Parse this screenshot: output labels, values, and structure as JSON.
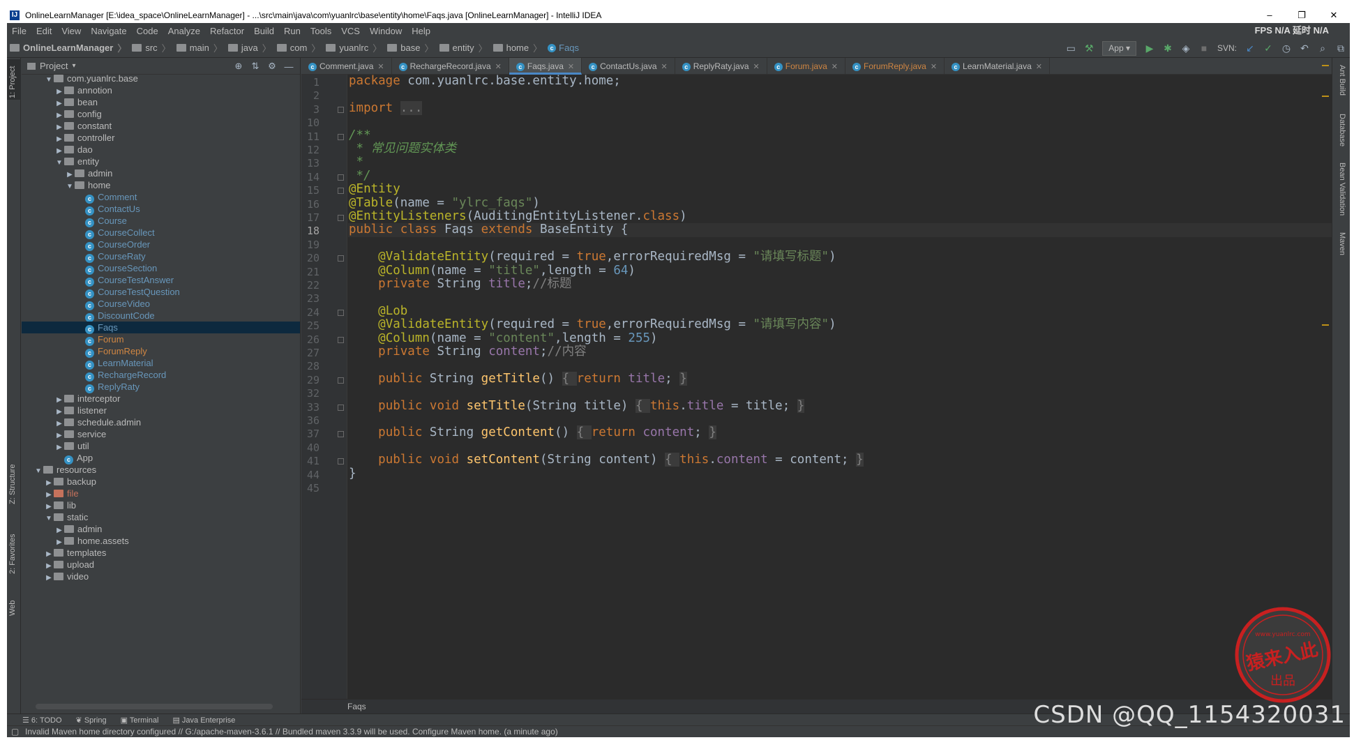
{
  "window": {
    "title": "OnlineLearnManager [E:\\idea_space\\OnlineLearnManager] - ...\\src\\main\\java\\com\\yuanlrc\\base\\entity\\home\\Faqs.java [OnlineLearnManager] - IntelliJ IDEA",
    "minimize": "–",
    "maximize": "❐",
    "close": "✕"
  },
  "menu": {
    "items": [
      "File",
      "Edit",
      "View",
      "Navigate",
      "Code",
      "Analyze",
      "Refactor",
      "Build",
      "Run",
      "Tools",
      "VCS",
      "Window",
      "Help"
    ],
    "fps": "FPS N/A 延时 N/A"
  },
  "breadcrumb": [
    "OnlineLearnManager",
    "src",
    "main",
    "java",
    "com",
    "yuanlrc",
    "base",
    "entity",
    "home",
    "Faqs"
  ],
  "toolbar": {
    "run_config": "App",
    "svn_label": "SVN:"
  },
  "project_panel": {
    "title": "Project",
    "tree": [
      {
        "label": "com.yuanlrc.base",
        "depth": 4,
        "type": "folder",
        "open": true
      },
      {
        "label": "annotion",
        "depth": 5,
        "type": "folder"
      },
      {
        "label": "bean",
        "depth": 5,
        "type": "folder"
      },
      {
        "label": "config",
        "depth": 5,
        "type": "folder"
      },
      {
        "label": "constant",
        "depth": 5,
        "type": "folder"
      },
      {
        "label": "controller",
        "depth": 5,
        "type": "folder"
      },
      {
        "label": "dao",
        "depth": 5,
        "type": "folder"
      },
      {
        "label": "entity",
        "depth": 5,
        "type": "folder",
        "open": true
      },
      {
        "label": "admin",
        "depth": 6,
        "type": "folder"
      },
      {
        "label": "home",
        "depth": 6,
        "type": "folder",
        "open": true
      },
      {
        "label": "Comment",
        "depth": 7,
        "type": "class",
        "color": "blue"
      },
      {
        "label": "ContactUs",
        "depth": 7,
        "type": "class",
        "color": "blue"
      },
      {
        "label": "Course",
        "depth": 7,
        "type": "class",
        "color": "blue"
      },
      {
        "label": "CourseCollect",
        "depth": 7,
        "type": "class",
        "color": "blue"
      },
      {
        "label": "CourseOrder",
        "depth": 7,
        "type": "class",
        "color": "blue"
      },
      {
        "label": "CourseRaty",
        "depth": 7,
        "type": "class",
        "color": "blue"
      },
      {
        "label": "CourseSection",
        "depth": 7,
        "type": "class",
        "color": "blue"
      },
      {
        "label": "CourseTestAnswer",
        "depth": 7,
        "type": "class",
        "color": "blue"
      },
      {
        "label": "CourseTestQuestion",
        "depth": 7,
        "type": "class",
        "color": "blue"
      },
      {
        "label": "CourseVideo",
        "depth": 7,
        "type": "class",
        "color": "blue"
      },
      {
        "label": "DiscountCode",
        "depth": 7,
        "type": "class",
        "color": "blue"
      },
      {
        "label": "Faqs",
        "depth": 7,
        "type": "class",
        "color": "blue",
        "selected": true
      },
      {
        "label": "Forum",
        "depth": 7,
        "type": "class",
        "color": "orange"
      },
      {
        "label": "ForumReply",
        "depth": 7,
        "type": "class",
        "color": "orange"
      },
      {
        "label": "LearnMaterial",
        "depth": 7,
        "type": "class",
        "color": "blue"
      },
      {
        "label": "RechargeRecord",
        "depth": 7,
        "type": "class",
        "color": "blue"
      },
      {
        "label": "ReplyRaty",
        "depth": 7,
        "type": "class",
        "color": "blue"
      },
      {
        "label": "interceptor",
        "depth": 5,
        "type": "folder"
      },
      {
        "label": "listener",
        "depth": 5,
        "type": "folder"
      },
      {
        "label": "schedule.admin",
        "depth": 5,
        "type": "folder"
      },
      {
        "label": "service",
        "depth": 5,
        "type": "folder"
      },
      {
        "label": "util",
        "depth": 5,
        "type": "folder"
      },
      {
        "label": "App",
        "depth": 5,
        "type": "class",
        "color": "plain"
      },
      {
        "label": "resources",
        "depth": 3,
        "type": "folder",
        "open": true
      },
      {
        "label": "backup",
        "depth": 4,
        "type": "folder"
      },
      {
        "label": "file",
        "depth": 4,
        "type": "folder-red",
        "color": "red"
      },
      {
        "label": "lib",
        "depth": 4,
        "type": "folder"
      },
      {
        "label": "static",
        "depth": 4,
        "type": "folder",
        "open": true
      },
      {
        "label": "admin",
        "depth": 5,
        "type": "folder"
      },
      {
        "label": "home.assets",
        "depth": 5,
        "type": "folder"
      },
      {
        "label": "templates",
        "depth": 4,
        "type": "folder"
      },
      {
        "label": "upload",
        "depth": 4,
        "type": "folder"
      },
      {
        "label": "video",
        "depth": 4,
        "type": "folder"
      }
    ]
  },
  "tabs": [
    {
      "label": "Comment.java",
      "active": false
    },
    {
      "label": "RechargeRecord.java",
      "active": false
    },
    {
      "label": "Faqs.java",
      "active": true
    },
    {
      "label": "ContactUs.java",
      "active": false
    },
    {
      "label": "ReplyRaty.java",
      "active": false
    },
    {
      "label": "Forum.java",
      "active": false,
      "color": "orange"
    },
    {
      "label": "ForumReply.java",
      "active": false,
      "color": "orange"
    },
    {
      "label": "LearnMaterial.java",
      "active": false
    }
  ],
  "editor": {
    "current_line": "18",
    "footer_crumb": "Faqs",
    "lines": [
      {
        "n": "1",
        "html": "<span class=\"kw\">package</span> com.yuanlrc.base.entity.home;"
      },
      {
        "n": "2",
        "html": ""
      },
      {
        "n": "3",
        "html": "<span class=\"kw\">import</span> <span class=\"fb\">...</span>"
      },
      {
        "n": "10",
        "html": ""
      },
      {
        "n": "11",
        "html": "<span class=\"cm\">/**</span>"
      },
      {
        "n": "12",
        "html": "<span class=\"cm\"> * 常见问题实体类</span>"
      },
      {
        "n": "13",
        "html": "<span class=\"cm\"> *</span>"
      },
      {
        "n": "14",
        "html": "<span class=\"cm\"> */</span>"
      },
      {
        "n": "15",
        "html": "<span class=\"an\">@Entity</span>"
      },
      {
        "n": "16",
        "html": "<span class=\"an\">@Table</span>(name = <span class=\"st\">\"ylrc_faqs\"</span>)"
      },
      {
        "n": "17",
        "html": "<span class=\"an\">@EntityListeners</span>(AuditingEntityListener.<span class=\"kw\">class</span>)"
      },
      {
        "n": "18",
        "html": "<span class=\"kw\">public class</span> Faqs <span class=\"kw\">extends</span> BaseEntity {"
      },
      {
        "n": "19",
        "html": ""
      },
      {
        "n": "20",
        "html": "    <span class=\"an\">@ValidateEntity</span>(required = <span class=\"kw\">true</span>,errorRequiredMsg = <span class=\"st\">\"请填写标题\"</span>)"
      },
      {
        "n": "21",
        "html": "    <span class=\"an\">@Column</span>(name = <span class=\"st\">\"title\"</span>,length = <span class=\"nm\">64</span>)"
      },
      {
        "n": "22",
        "html": "    <span class=\"kw\">private</span> String <span class=\"fd\">title</span>;<span class=\"lc\">//标题</span>"
      },
      {
        "n": "23",
        "html": ""
      },
      {
        "n": "24",
        "html": "    <span class=\"an\">@Lob</span>"
      },
      {
        "n": "25",
        "html": "    <span class=\"an\">@ValidateEntity</span>(required = <span class=\"kw\">true</span>,errorRequiredMsg = <span class=\"st\">\"请填写内容\"</span>)"
      },
      {
        "n": "26",
        "html": "    <span class=\"an\">@Column</span>(name = <span class=\"st\">\"content\"</span>,length = <span class=\"nm\">255</span>)"
      },
      {
        "n": "27",
        "html": "    <span class=\"kw\">private</span> String <span class=\"fd\">content</span>;<span class=\"lc\">//内容</span>"
      },
      {
        "n": "28",
        "html": ""
      },
      {
        "n": "29",
        "html": "    <span class=\"kw\">public</span> String <span class=\"fn\">getTitle</span>() <span class=\"fb\">{ </span><span class=\"kw\">return</span> <span class=\"fd\">title</span>; <span class=\"fb\">}</span>"
      },
      {
        "n": "32",
        "html": ""
      },
      {
        "n": "33",
        "html": "    <span class=\"kw\">public void</span> <span class=\"fn\">setTitle</span>(String title) <span class=\"fb\">{ </span><span class=\"kw\">this</span>.<span class=\"fd\">title</span> = title; <span class=\"fb\">}</span>"
      },
      {
        "n": "36",
        "html": ""
      },
      {
        "n": "37",
        "html": "    <span class=\"kw\">public</span> String <span class=\"fn\">getContent</span>() <span class=\"fb\">{ </span><span class=\"kw\">return</span> <span class=\"fd\">content</span>; <span class=\"fb\">}</span>"
      },
      {
        "n": "40",
        "html": ""
      },
      {
        "n": "41",
        "html": "    <span class=\"kw\">public void</span> <span class=\"fn\">setContent</span>(String content) <span class=\"fb\">{ </span><span class=\"kw\">this</span>.<span class=\"fd\">content</span> = content; <span class=\"fb\">}</span>"
      },
      {
        "n": "44",
        "html": "}"
      },
      {
        "n": "45",
        "html": ""
      }
    ]
  },
  "side_tools": {
    "left": [
      "1: Project",
      "Z: Structure",
      "2: Favorites",
      "Web"
    ],
    "right": [
      "Ant Build",
      "Database",
      "Bean Validation",
      "Maven"
    ]
  },
  "bottom_tools": [
    "6: TODO",
    "Spring",
    "Terminal",
    "Java Enterprise"
  ],
  "status": {
    "message": "Invalid Maven home directory configured // G:/apache-maven-3.6.1 // Bundled maven 3.3.9 will be used.  Configure Maven home.  (a minute ago)"
  },
  "watermark": "CSDN @QQ_1154320031",
  "stamp": {
    "text": "猿来入此",
    "sub": "出品",
    "url": "www.yuanlrc.com"
  },
  "colors": {
    "bg": "#3c3f41",
    "editor_bg": "#2b2b2b",
    "keyword": "#cc7832",
    "annotation": "#bbb529",
    "string": "#6a8759",
    "selection": "#0d293e",
    "accent": "#4a88c7"
  }
}
